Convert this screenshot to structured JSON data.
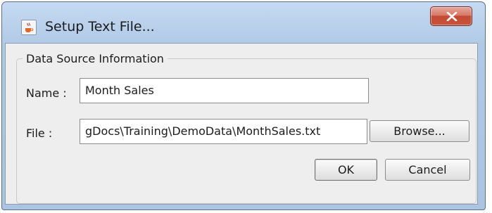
{
  "window": {
    "title": "Setup Text File..."
  },
  "group": {
    "legend": "Data Source Information"
  },
  "fields": {
    "name_label": "Name :",
    "name_value": "Month Sales",
    "file_label": "File :",
    "file_value": "gDocs\\Training\\DemoData\\MonthSales.txt"
  },
  "buttons": {
    "browse": "Browse...",
    "ok": "OK",
    "cancel": "Cancel"
  },
  "icons": {
    "app": "java-cup-icon",
    "close": "close-icon"
  },
  "colors": {
    "close_button": "#c7533a",
    "title_bar": "#b7cfea"
  }
}
